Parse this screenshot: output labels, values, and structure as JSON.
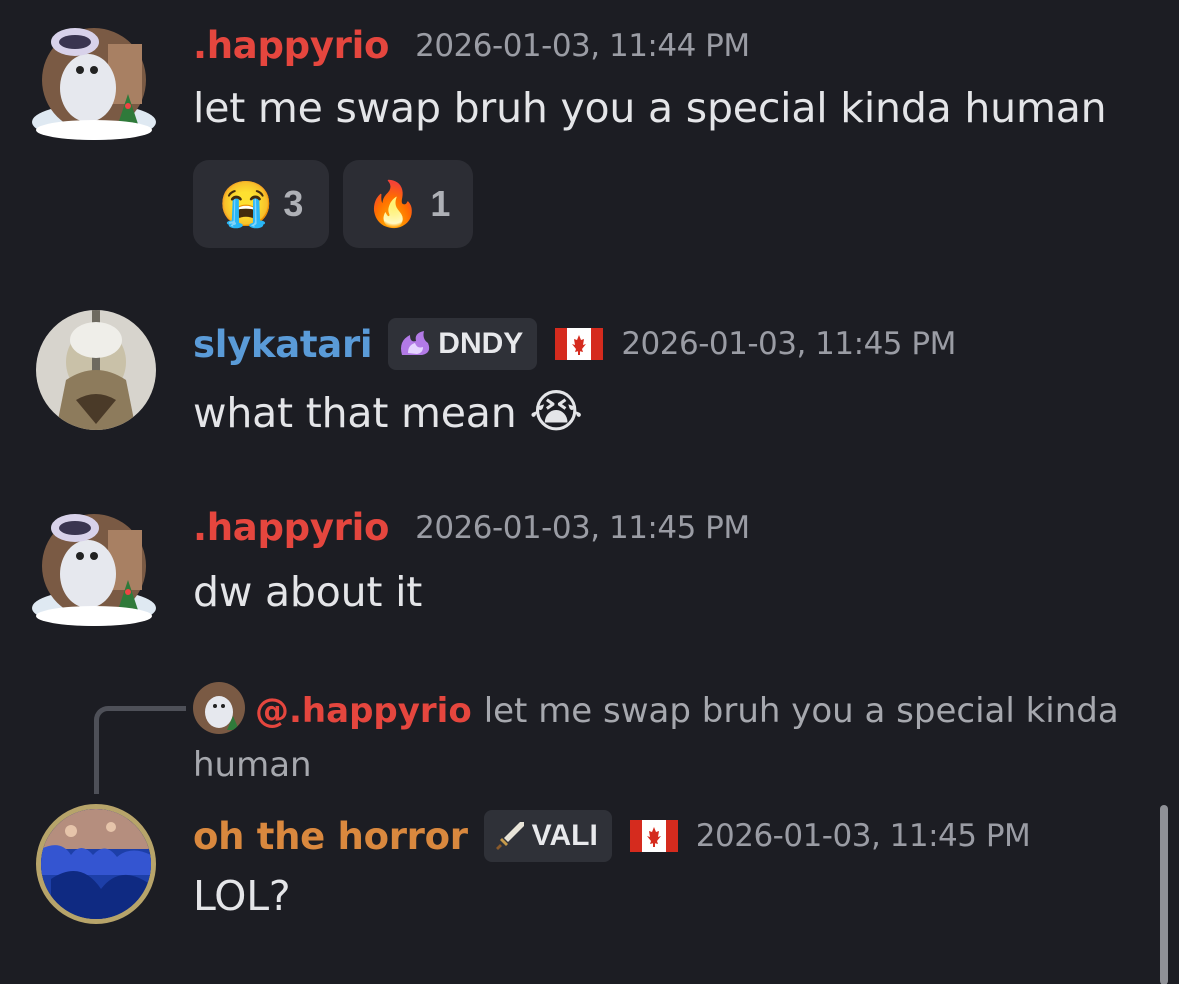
{
  "messages": [
    {
      "username": ".happyrio",
      "timestamp": "2026-01-03, 11:44 PM",
      "text": "let me swap bruh you a special kinda human",
      "reactions": [
        {
          "emoji": "😭",
          "count": "3"
        },
        {
          "emoji": "🔥",
          "count": "1"
        }
      ]
    },
    {
      "username": "slykatari",
      "tag": "DNDY",
      "flag": "canada",
      "timestamp": "2026-01-03, 11:45 PM",
      "text": "what that mean",
      "emoji": "😭"
    },
    {
      "username": ".happyrio",
      "timestamp": "2026-01-03, 11:45 PM",
      "text": "dw about it"
    },
    {
      "reply": {
        "mention": "@.happyrio",
        "text": "let me swap bruh you a special kinda human"
      },
      "username": "oh the horror",
      "tag": "VALI",
      "flag": "canada",
      "timestamp": "2026-01-03, 11:45 PM",
      "text": "LOL?"
    }
  ],
  "colors": {
    "background": "#1c1d23",
    "username_red": "#e5463e",
    "username_blue": "#5a9bd8",
    "username_orange": "#d9883e"
  }
}
